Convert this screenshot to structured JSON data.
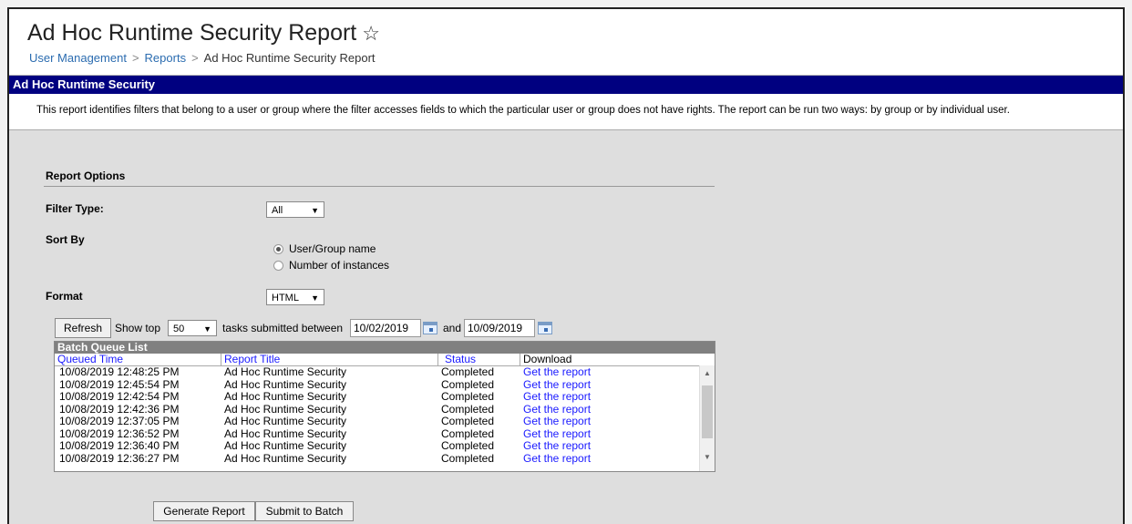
{
  "header": {
    "title": "Ad Hoc Runtime Security Report",
    "breadcrumb": [
      "User Management",
      "Reports",
      "Ad Hoc Runtime Security Report"
    ]
  },
  "section": {
    "title": "Ad Hoc Runtime Security",
    "description": "This report identifies filters that belong to a user or group where the filter accesses fields to which the particular user or group does not have rights. The report can be run two ways: by group or by individual user."
  },
  "options": {
    "heading": "Report Options",
    "filter_type_label": "Filter Type:",
    "filter_type_value": "All",
    "sort_by_label": "Sort By",
    "sort_options": [
      {
        "label": "User/Group name",
        "checked": true
      },
      {
        "label": "Number of instances",
        "checked": false
      }
    ],
    "format_label": "Format",
    "format_value": "HTML"
  },
  "batch_controls": {
    "refresh_label": "Refresh",
    "show_top_label": "Show top",
    "show_top_value": "50",
    "between_label": "tasks submitted between",
    "start_date": "10/02/2019",
    "and_label": "and",
    "end_date": "10/09/2019"
  },
  "queue": {
    "title": "Batch Queue List",
    "columns": [
      "Queued Time",
      "Report Title",
      "Status",
      "Download"
    ],
    "rows": [
      {
        "time": "10/08/2019 12:48:25 PM",
        "title": "Ad Hoc Runtime Security",
        "status": "Completed",
        "download": "Get the report"
      },
      {
        "time": "10/08/2019 12:45:54 PM",
        "title": "Ad Hoc Runtime Security",
        "status": "Completed",
        "download": "Get the report"
      },
      {
        "time": "10/08/2019 12:42:54 PM",
        "title": "Ad Hoc Runtime Security",
        "status": "Completed",
        "download": "Get the report"
      },
      {
        "time": "10/08/2019 12:42:36 PM",
        "title": "Ad Hoc Runtime Security",
        "status": "Completed",
        "download": "Get the report"
      },
      {
        "time": "10/08/2019 12:37:05 PM",
        "title": "Ad Hoc Runtime Security",
        "status": "Completed",
        "download": "Get the report"
      },
      {
        "time": "10/08/2019 12:36:52 PM",
        "title": "Ad Hoc Runtime Security",
        "status": "Completed",
        "download": "Get the report"
      },
      {
        "time": "10/08/2019 12:36:40 PM",
        "title": "Ad Hoc Runtime Security",
        "status": "Completed",
        "download": "Get the report"
      },
      {
        "time": "10/08/2019 12:36:27 PM",
        "title": "Ad Hoc Runtime Security",
        "status": "Completed",
        "download": "Get the report"
      }
    ]
  },
  "actions": {
    "generate_label": "Generate Report",
    "submit_label": "Submit to Batch"
  },
  "colors": {
    "section_bar": "#000080",
    "link": "#1a1aff",
    "background": "#dedede"
  }
}
